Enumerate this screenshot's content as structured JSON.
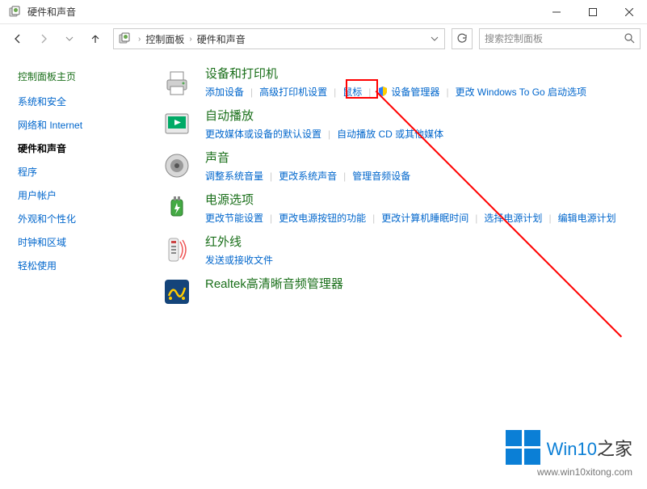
{
  "window": {
    "title": "硬件和声音"
  },
  "breadcrumb": {
    "root": "控制面板",
    "current": "硬件和声音"
  },
  "search": {
    "placeholder": "搜索控制面板"
  },
  "sidebar": {
    "heading": "控制面板主页",
    "items": [
      {
        "label": "系统和安全",
        "active": false
      },
      {
        "label": "网络和 Internet",
        "active": false
      },
      {
        "label": "硬件和声音",
        "active": true
      },
      {
        "label": "程序",
        "active": false
      },
      {
        "label": "用户帐户",
        "active": false
      },
      {
        "label": "外观和个性化",
        "active": false
      },
      {
        "label": "时钟和区域",
        "active": false
      },
      {
        "label": "轻松使用",
        "active": false
      }
    ]
  },
  "categories": [
    {
      "title": "设备和打印机",
      "icon": "printer",
      "links": [
        {
          "label": "添加设备"
        },
        {
          "label": "高级打印机设置"
        },
        {
          "label": "鼠标",
          "highlight": true
        },
        {
          "label": "设备管理器",
          "shield": true
        },
        {
          "label": "更改 Windows To Go 启动选项"
        }
      ]
    },
    {
      "title": "自动播放",
      "icon": "autoplay",
      "links": [
        {
          "label": "更改媒体或设备的默认设置"
        },
        {
          "label": "自动播放 CD 或其他媒体"
        }
      ]
    },
    {
      "title": "声音",
      "icon": "sound",
      "links": [
        {
          "label": "调整系统音量"
        },
        {
          "label": "更改系统声音"
        },
        {
          "label": "管理音频设备"
        }
      ]
    },
    {
      "title": "电源选项",
      "icon": "power",
      "links": [
        {
          "label": "更改节能设置"
        },
        {
          "label": "更改电源按钮的功能"
        },
        {
          "label": "更改计算机睡眠时间"
        },
        {
          "label": "选择电源计划"
        },
        {
          "label": "编辑电源计划"
        }
      ]
    },
    {
      "title": "红外线",
      "icon": "infrared",
      "links": [
        {
          "label": "发送或接收文件"
        }
      ]
    },
    {
      "title": "Realtek高清晰音频管理器",
      "icon": "realtek",
      "links": []
    }
  ],
  "watermark": {
    "brand_a": "Win10",
    "brand_b": "之家",
    "url": "www.win10xitong.com"
  }
}
